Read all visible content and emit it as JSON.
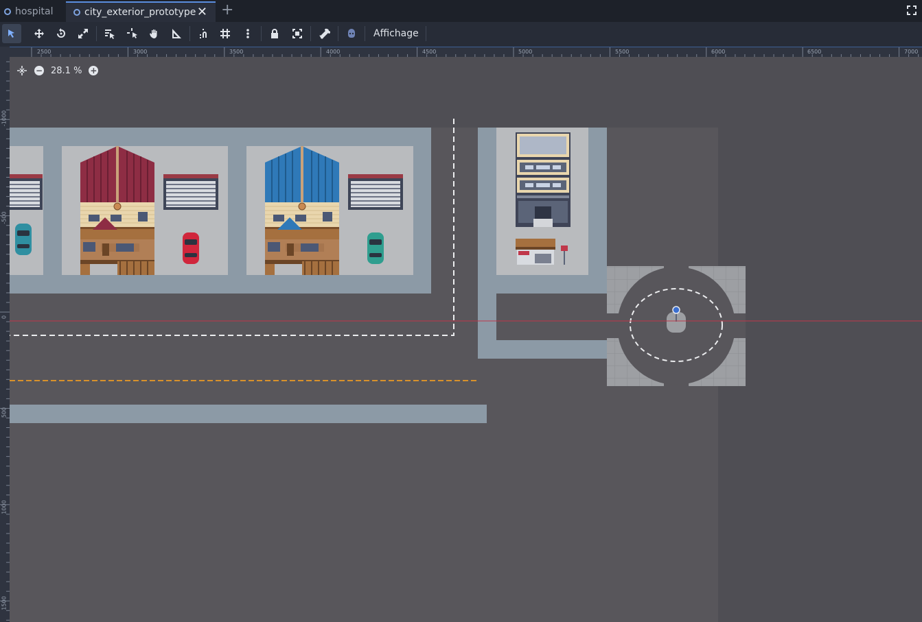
{
  "tabs": [
    {
      "label": "hospital",
      "active": false
    },
    {
      "label": "city_exterior_prototype",
      "active": true
    }
  ],
  "tab_close_glyph": "✕",
  "tab_add_glyph": "+",
  "toolbar": {
    "tools": [
      {
        "name": "select-mode-icon",
        "active": true
      },
      {
        "name": "move-mode-icon"
      },
      {
        "name": "rotate-mode-icon"
      },
      {
        "name": "scale-mode-icon"
      },
      {
        "name": "list-select-icon"
      },
      {
        "name": "pivot-mode-icon"
      },
      {
        "name": "pan-mode-icon"
      },
      {
        "name": "ruler-mode-icon"
      },
      {
        "name": "smart-snap-icon"
      },
      {
        "name": "grid-snap-icon"
      },
      {
        "name": "snap-options-icon"
      },
      {
        "name": "lock-icon"
      },
      {
        "name": "group-icon"
      },
      {
        "name": "bone-icon"
      },
      {
        "name": "node-icon"
      }
    ],
    "view_menu_label": "Affichage"
  },
  "zoom": {
    "value": "28.1 %",
    "minus": "−",
    "plus": "+"
  },
  "ruler_top": [
    "2500",
    "3000",
    "3500",
    "4000",
    "4500",
    "5000",
    "5500",
    "6000",
    "6500",
    "7000"
  ],
  "ruler_left": [
    "-1000",
    "-500",
    "0",
    "500",
    "1000",
    "1500"
  ],
  "colors": {
    "background": "#4f4e54",
    "sidewalk": "#8c9aa6",
    "lot": "#b9bbbe",
    "road_line": "#d9922b",
    "axis_x": "#c0374a",
    "roof_red": "#8e2d44",
    "roof_blue": "#2f79b8"
  }
}
